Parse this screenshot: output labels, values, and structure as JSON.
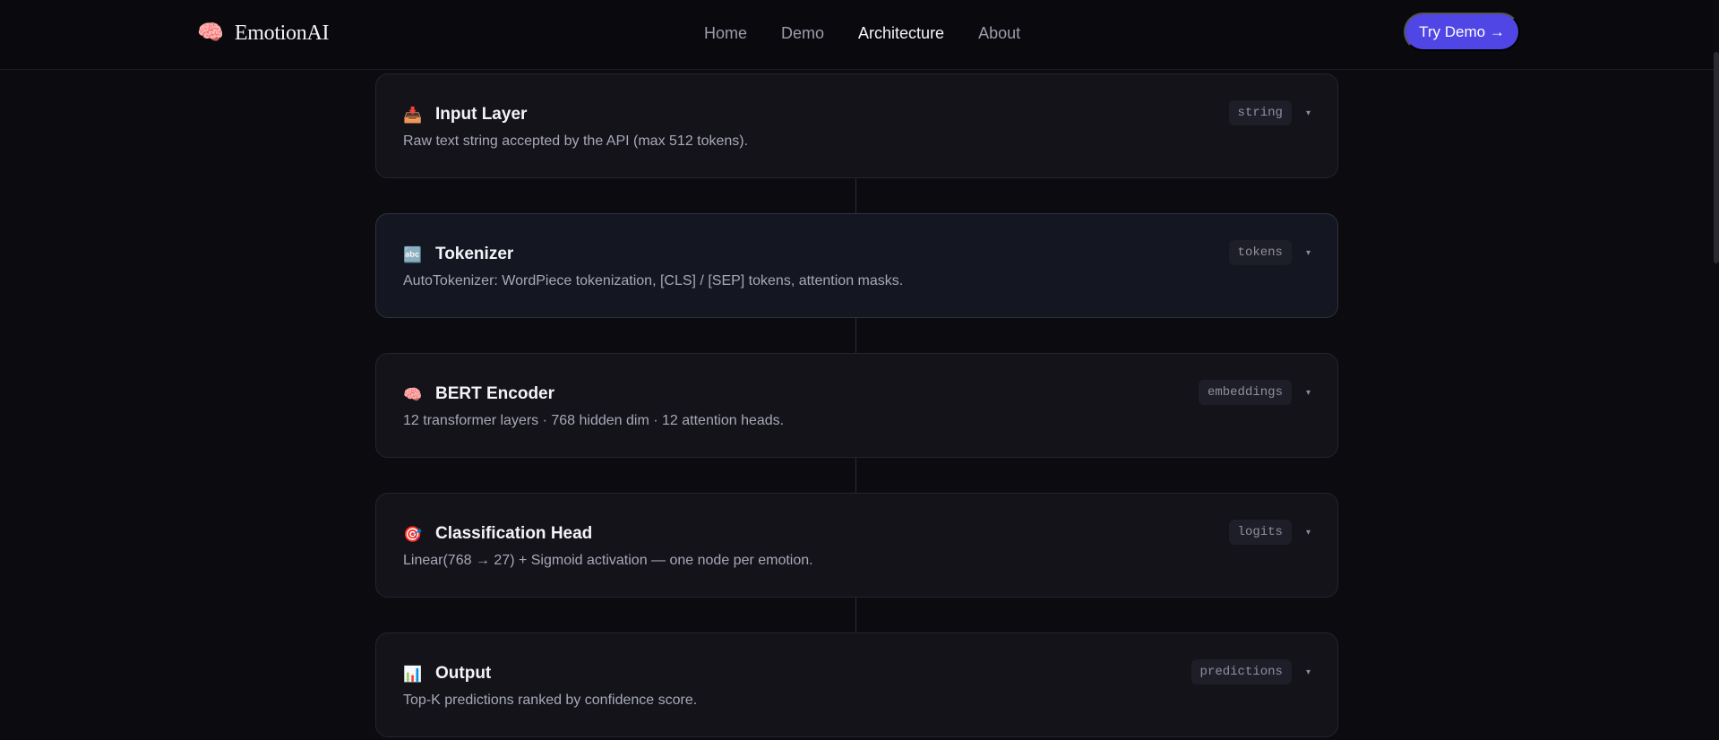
{
  "brand": {
    "icon": "🧠",
    "icon_name": "brain-icon",
    "name": "EmotionAI"
  },
  "nav": {
    "links": [
      {
        "label": "Home",
        "active": false
      },
      {
        "label": "Demo",
        "active": false
      },
      {
        "label": "Architecture",
        "active": true
      },
      {
        "label": "About",
        "active": false
      }
    ],
    "cta_label": "Try Demo →"
  },
  "colors": {
    "background": "#0b0b10",
    "card": "#131319",
    "accent": "#4f46e5",
    "muted_text": "#a7a9b8"
  },
  "pipeline": [
    {
      "icon": "📥",
      "icon_name": "inbox-tray-icon",
      "title": "Input Layer",
      "description": "Raw text string accepted by the API (max 512 tokens).",
      "tag": "string",
      "expanded": false
    },
    {
      "icon": "🔤",
      "icon_name": "abc-icon",
      "title": "Tokenizer",
      "description": "AutoTokenizer: WordPiece tokenization, [CLS] / [SEP] tokens, attention masks.",
      "tag": "tokens",
      "expanded": false
    },
    {
      "icon": "🧠",
      "icon_name": "brain-icon",
      "title": "BERT Encoder",
      "description": "12 transformer layers · 768 hidden dim · 12 attention heads.",
      "tag": "embeddings",
      "expanded": false
    },
    {
      "icon": "🎯",
      "icon_name": "target-icon",
      "title": "Classification Head",
      "description": "Linear(768 → 27) + Sigmoid activation — one node per emotion.",
      "tag": "logits",
      "expanded": false
    },
    {
      "icon": "📊",
      "icon_name": "bar-chart-icon",
      "title": "Output",
      "description": "Top-K predictions ranked by confidence score.",
      "tag": "predictions",
      "expanded": false
    }
  ],
  "chevron_glyph": "▾"
}
